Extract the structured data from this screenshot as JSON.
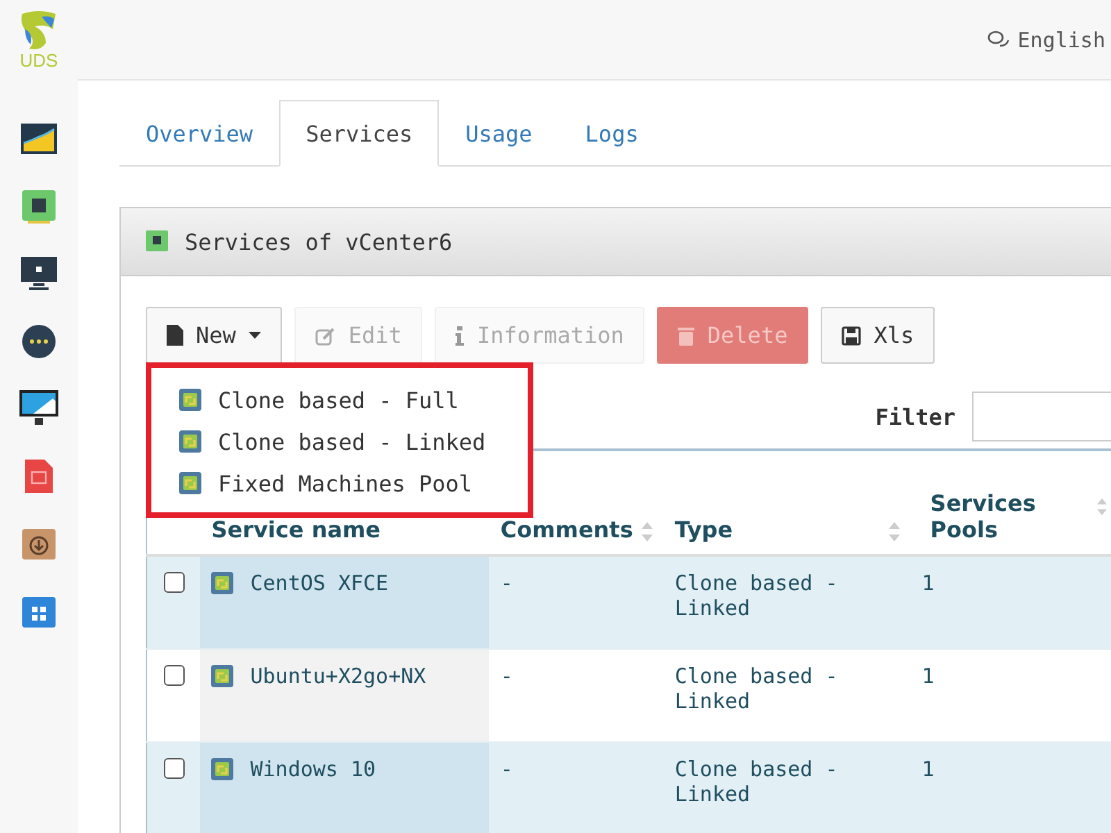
{
  "header": {
    "language": "English"
  },
  "logo": {
    "text": "UDS"
  },
  "tabs": [
    {
      "label": "Overview",
      "selected": false
    },
    {
      "label": "Services",
      "selected": true
    },
    {
      "label": "Usage",
      "selected": false
    },
    {
      "label": "Logs",
      "selected": false
    }
  ],
  "panel": {
    "title": "Services of vCenter6"
  },
  "toolbar": [
    {
      "label": "New",
      "kind": "new",
      "disabled": false
    },
    {
      "label": "Edit",
      "kind": "edit",
      "disabled": true
    },
    {
      "label": "Information",
      "kind": "info",
      "disabled": true
    },
    {
      "label": "Delete",
      "kind": "delete",
      "disabled": true
    },
    {
      "label": "Xls",
      "kind": "xls",
      "disabled": false
    }
  ],
  "new_menu": {
    "items": [
      "Clone based - Full",
      "Clone based - Linked",
      "Fixed Machines Pool"
    ]
  },
  "filter": {
    "label": "Filter"
  },
  "table": {
    "columns": [
      "Service name",
      "Comments",
      "Type",
      "Services Pools"
    ],
    "rows": [
      {
        "checked": false,
        "name": "CentOS XFCE",
        "comments": "-",
        "type": "Clone based - Linked",
        "pools": "1"
      },
      {
        "checked": false,
        "name": "Ubuntu+X2go+NX",
        "comments": "-",
        "type": "Clone based - Linked",
        "pools": "1"
      },
      {
        "checked": false,
        "name": "Windows 10",
        "comments": "-",
        "type": "Clone based - Linked",
        "pools": "1"
      }
    ]
  }
}
